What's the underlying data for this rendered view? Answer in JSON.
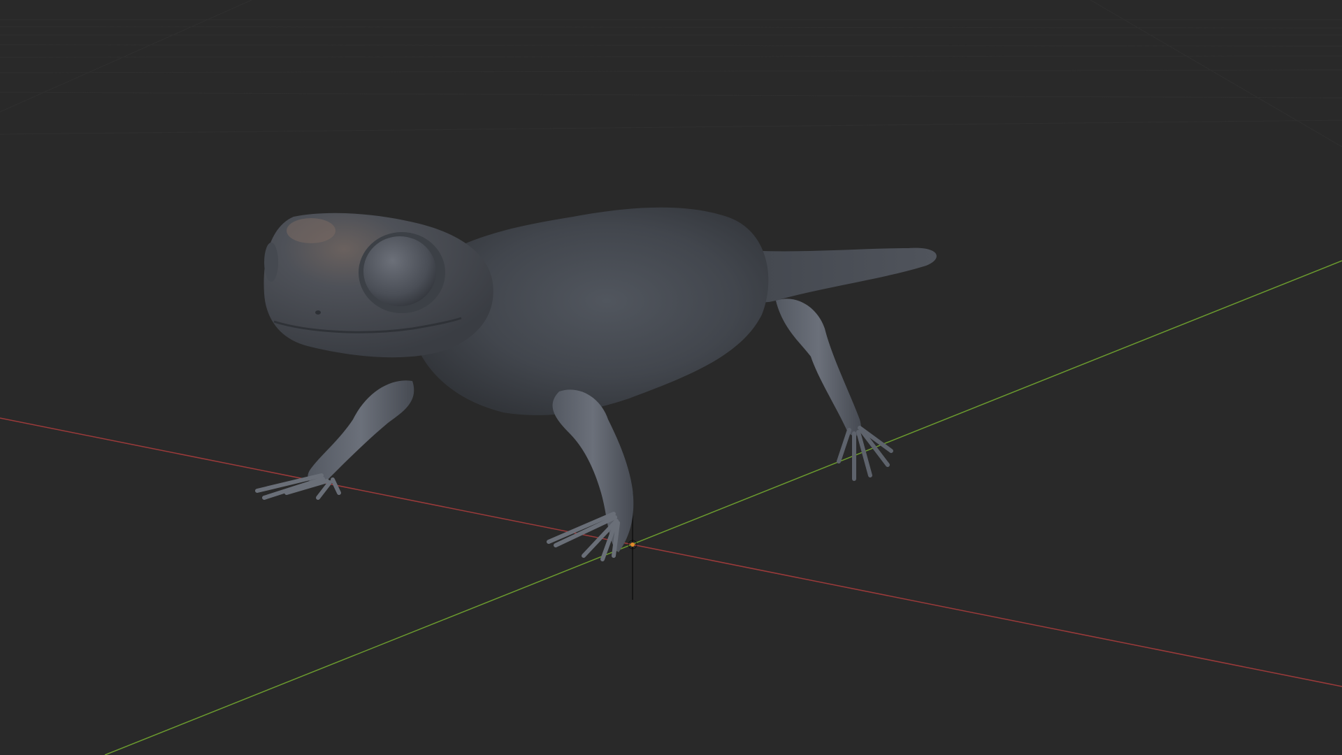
{
  "viewport": {
    "background_color": "#292929",
    "grid_line_color": "#303030",
    "x_axis_color": "#9b3a3a",
    "y_axis_color": "#6b9a2e",
    "z_axis_color": "#111111",
    "origin_color": "#e08a2a"
  },
  "scene": {
    "object": "salamander-sculpt",
    "material_color": "#4b5058",
    "shading": "solid-matcap"
  }
}
